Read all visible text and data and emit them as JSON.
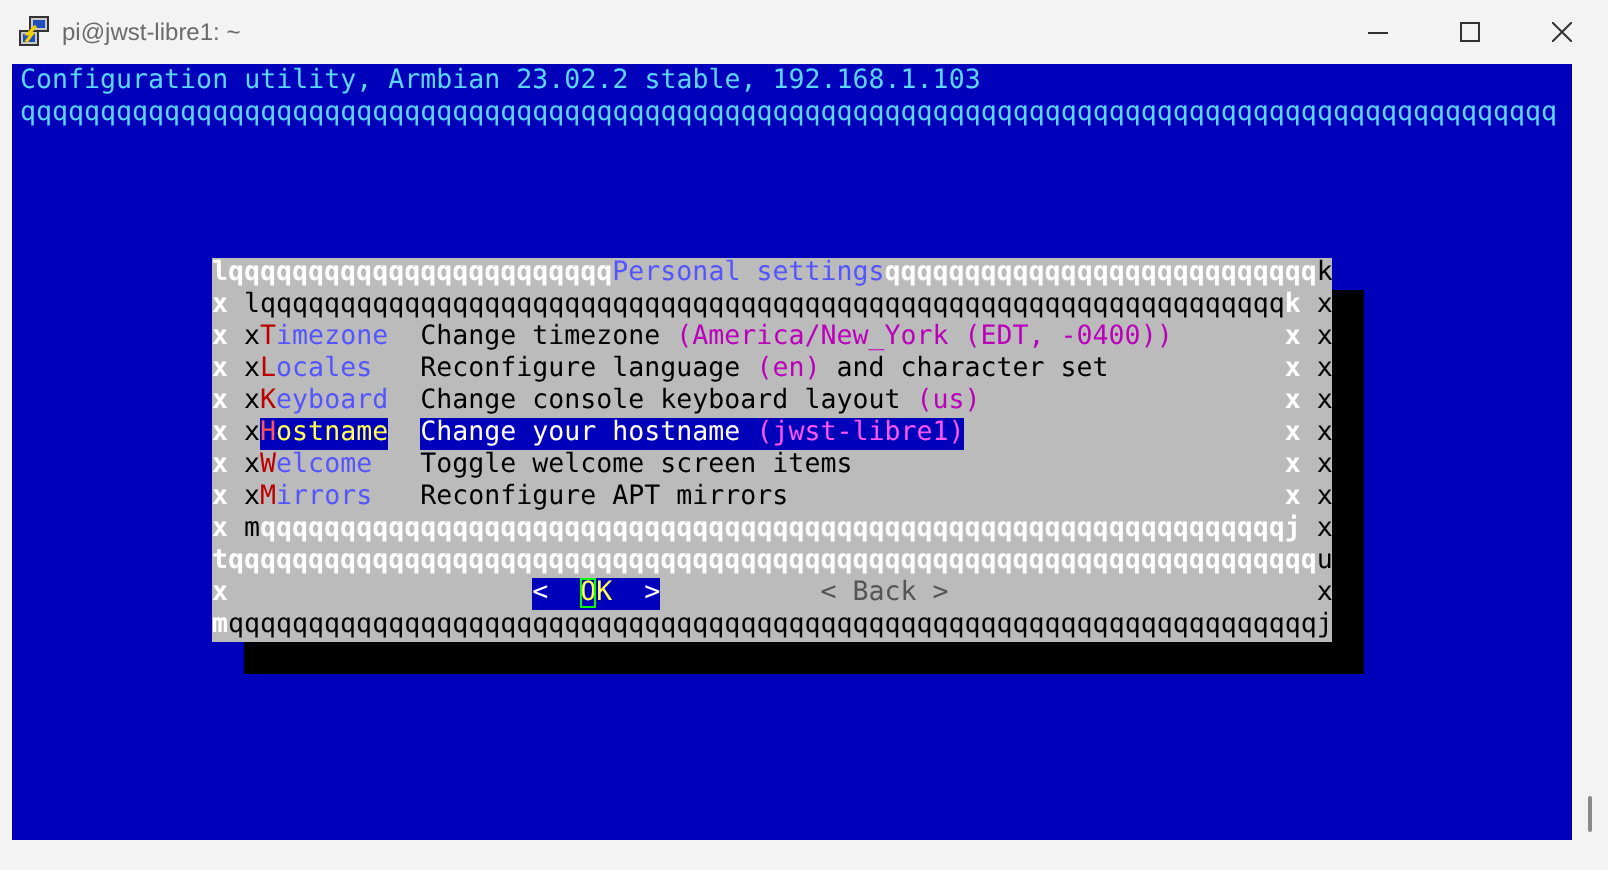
{
  "window": {
    "title": "pi@jwst-libre1: ~"
  },
  "terminal": {
    "header": "Configuration utility, Armbian 23.02.2 stable, 192.168.1.103",
    "header_rule": "qqqqqqqqqqqqqqqqqqqqqqqqqqqqqqqqqqqqqqqqqqqqqqqqqqqqqqqqqqqqqqqqqqqqqqqqqqqqqqqqqqqqqqqqqqqqqqqq"
  },
  "dialog": {
    "title": "Personal settings",
    "top": {
      "left": "l",
      "rule_left": "qqqqqqqqqqqqqqqqqqqqqqqq",
      "rule_right": "qqqqqqqqqqqqqqqqqqqqqqqqqqq",
      "right": "k"
    },
    "inner_top": {
      "outer_left": "x",
      "left": "l",
      "rule": "qqqqqqqqqqqqqqqqqqqqqqqqqqqqqqqqqqqqqqqqqqqqqqqqqqqqqqqqqqqqqqqq",
      "right": "k",
      "outer_right": "x"
    },
    "items": [
      {
        "outer_left": "x",
        "inner_left": "x",
        "hotkey": "T",
        "label": "imezone",
        "description": [
          {
            "kind": "plain",
            "text": "Change timezone "
          },
          {
            "kind": "value",
            "text": "(America/New_York (EDT, -0400))"
          }
        ],
        "inner_right": "x",
        "outer_right": "x",
        "selected": false
      },
      {
        "outer_left": "x",
        "inner_left": "x",
        "hotkey": "L",
        "label": "ocales",
        "description": [
          {
            "kind": "plain",
            "text": "Reconfigure language "
          },
          {
            "kind": "value",
            "text": "(en)"
          },
          {
            "kind": "plain",
            "text": " and character set"
          }
        ],
        "inner_right": "x",
        "outer_right": "x",
        "selected": false
      },
      {
        "outer_left": "x",
        "inner_left": "x",
        "hotkey": "K",
        "label": "eyboard",
        "description": [
          {
            "kind": "plain",
            "text": "Change console keyboard layout "
          },
          {
            "kind": "value",
            "text": "(us)"
          }
        ],
        "inner_right": "x",
        "outer_right": "x",
        "selected": false
      },
      {
        "outer_left": "x",
        "inner_left": "x",
        "hotkey": "H",
        "label": "ostname",
        "description": [
          {
            "kind": "plain",
            "text": "Change your hostname "
          },
          {
            "kind": "value",
            "text": "(jwst-libre1)"
          }
        ],
        "inner_right": "x",
        "outer_right": "x",
        "selected": true
      },
      {
        "outer_left": "x",
        "inner_left": "x",
        "hotkey": "W",
        "label": "elcome",
        "description": [
          {
            "kind": "plain",
            "text": "Toggle welcome screen items"
          }
        ],
        "inner_right": "x",
        "outer_right": "x",
        "selected": false
      },
      {
        "outer_left": "x",
        "inner_left": "x",
        "hotkey": "M",
        "label": "irrors",
        "description": [
          {
            "kind": "plain",
            "text": "Reconfigure APT mirrors"
          }
        ],
        "inner_right": "x",
        "outer_right": "x",
        "selected": false
      }
    ],
    "inner_bottom": {
      "outer_left": "x",
      "left": "m",
      "rule": "qqqqqqqqqqqqqqqqqqqqqqqqqqqqqqqqqqqqqqqqqqqqqqqqqqqqqqqqqqqqqqqq",
      "right": "j",
      "outer_right": "x"
    },
    "separator": {
      "left": "t",
      "rule": "qqqqqqqqqqqqqqqqqqqqqqqqqqqqqqqqqqqqqqqqqqqqqqqqqqqqqqqqqqqqqqqqqqqq",
      "right": "u"
    },
    "button_row": {
      "left": "x",
      "right": "x"
    },
    "buttons": [
      {
        "open": "<",
        "label": "OK",
        "close": ">",
        "selected": true
      },
      {
        "open": "<",
        "label": "Back",
        "close": ">",
        "selected": false
      }
    ],
    "bottom": {
      "left": "m",
      "rule": "qqqqqqqqqqqqqqqqqqqqqqqqqqqqqqqqqqqqqqqqqqqqqqqqqqqqqqqqqqqqqqqqqqqq",
      "right": "j"
    }
  }
}
